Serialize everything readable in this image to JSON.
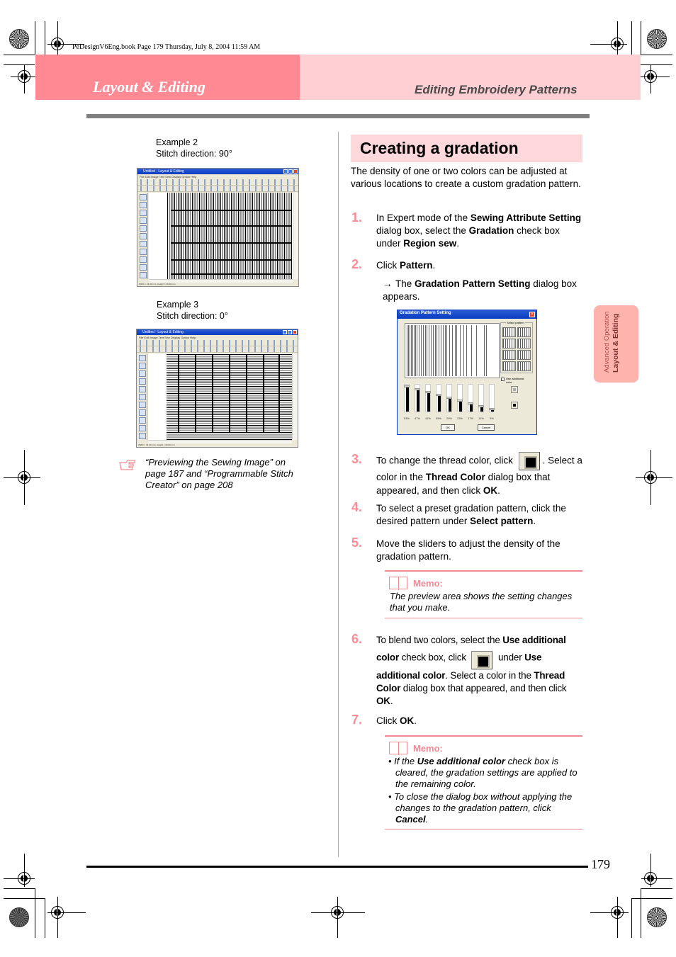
{
  "book_info": "PeDesignV6Eng.book  Page 179  Thursday, July 8, 2004  11:59 AM",
  "header": {
    "chapter": "Layout & Editing",
    "section": "Editing Embroidery Patterns",
    "colors": {
      "chapter_band": "#ff8a93",
      "section_band": "#ffcfd3",
      "accent": "#f08a94"
    }
  },
  "left_column": {
    "examples": [
      {
        "caption_line1": "Example 2",
        "caption_line2": "Stitch direction: 90°",
        "screenshot": {
          "window_title": "Untitled - Layout & Editing",
          "menu": "File  Edit  Image  Text  Sew  Display  Option  Help",
          "status": "Width = 41.00 mm, Height = 40.00 mm"
        }
      },
      {
        "caption_line1": "Example 3",
        "caption_line2": "Stitch direction: 0°",
        "screenshot": {
          "window_title": "Untitled - Layout & Editing",
          "menu": "File  Edit  Image  Text  Sew  Display  Option  Help",
          "status": "Width = 41.00 mm, Height = 40.00 mm"
        }
      }
    ],
    "reference": {
      "icon": "pointing-hand-icon",
      "text": "“Previewing the Sewing Image” on page 187 and “Programmable Stitch Creator” on page 208"
    }
  },
  "main": {
    "title": "Creating a gradation",
    "intro": "The density of one or two colors can be adjusted at various locations to create a custom gradation pattern.",
    "steps": [
      {
        "num": "1.",
        "parts": [
          "In Expert mode of the ",
          "Sewing Attribute Setting",
          " dialog box, select the ",
          "Gradation",
          " check box under ",
          "Region sew",
          "."
        ]
      },
      {
        "num": "2.",
        "parts": [
          "Click ",
          "Pattern",
          "."
        ],
        "result": {
          "arrow": "→",
          "parts": [
            "The ",
            "Gradation Pattern Setting",
            " dialog box appears."
          ]
        }
      },
      {
        "num": "3.",
        "parts": [
          "To change the thread color, click ",
          "[thread-color-button]",
          ". Select a color in the ",
          "Thread Color",
          " dialog box that appeared, and then click ",
          "OK",
          "."
        ]
      },
      {
        "num": "4.",
        "parts": [
          "To select a preset gradation pattern, click the desired pattern under ",
          "Select pattern",
          "."
        ]
      },
      {
        "num": "5.",
        "parts": [
          "Move the sliders to adjust the density of the gradation pattern."
        ]
      },
      {
        "num": "6.",
        "parts": [
          "To blend two colors, select the ",
          "Use additional color",
          " check box, click ",
          "[thread-color-button]",
          " under ",
          "Use additional color",
          ". Select a color in the ",
          "Thread Color",
          " dialog box that appeared, and then click ",
          "OK",
          "."
        ]
      },
      {
        "num": "7.",
        "parts": [
          "Click ",
          "OK",
          "."
        ]
      }
    ],
    "memos": [
      {
        "label": "Memo:",
        "text": "The preview area shows the setting changes that you make."
      },
      {
        "label": "Memo:",
        "bullets": [
          {
            "pre": "If the ",
            "bold": "Use additional color",
            "post": " check box is cleared, the gradation settings are applied to the remaining color."
          },
          {
            "pre": "To close the dialog box without applying the changes to the gradation pattern, click ",
            "bold": "Cancel",
            "post": "."
          }
        ]
      }
    ],
    "dialog": {
      "title": "Gradation Pattern Setting",
      "select_pattern_label": "Select pattern",
      "use_additional_color_label": "Use additional color",
      "use_additional_color_checked": false,
      "sliders": [
        {
          "label": "53%",
          "value": 53
        },
        {
          "label": "47%",
          "value": 47
        },
        {
          "label": "41%",
          "value": 41
        },
        {
          "label": "35%",
          "value": 35
        },
        {
          "label": "29%",
          "value": 29
        },
        {
          "label": "23%",
          "value": 23
        },
        {
          "label": "17%",
          "value": 17
        },
        {
          "label": "11%",
          "value": 11
        },
        {
          "label": "5%",
          "value": 5
        }
      ],
      "ok_label": "OK",
      "cancel_label": "Cancel"
    }
  },
  "side_tab": {
    "subtitle": "Advanced Operation",
    "title": "Layout & Editing"
  },
  "footer": {
    "page_number": "179"
  }
}
